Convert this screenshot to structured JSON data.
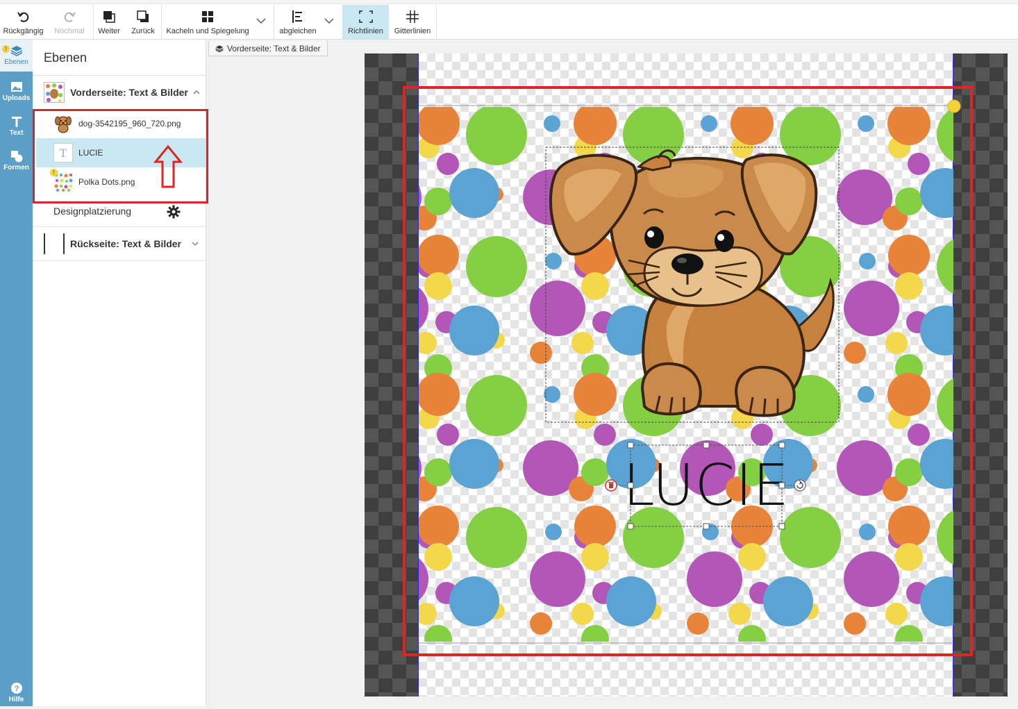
{
  "toolbar": {
    "undo": "Rückgängig",
    "redo": "Nochmal",
    "forward": "Weiter",
    "backward": "Zurück",
    "tiles": "Kacheln und Spiegelung",
    "align": "abgleichen",
    "guides": "Richtlinien",
    "grid": "Gitterlinien"
  },
  "rail": {
    "layers": "Ebenen",
    "uploads": "Uploads",
    "text": "Text",
    "shapes": "Formen",
    "help": "Hilfe"
  },
  "panel": {
    "title": "Ebenen",
    "front_group": "Vorderseite: Text & Bilder",
    "layers": [
      {
        "name": "dog-3542195_960_720.png"
      },
      {
        "name": "LUCIE"
      },
      {
        "name": "Polka Dots.png"
      }
    ],
    "placement": "Designplatzierung",
    "back_group": "Rückseite: Text & Bilder"
  },
  "canvas": {
    "tab_label": "Vorderseite: Text & Bilder",
    "text_layer": "LUCIE"
  },
  "colors": {
    "rail": "#5b9ec6",
    "selected_row": "#c9e8f1",
    "annotation_red": "#e02424",
    "dot_orange": "#e8843a",
    "dot_green": "#84cf43",
    "dot_blue": "#5aa3d3",
    "dot_purple": "#b257b8",
    "dot_yellow": "#f2d84a"
  },
  "icons": [
    "undo-icon",
    "redo-icon",
    "forward-icon",
    "backward-icon",
    "tiles-icon",
    "align-icon",
    "guides-icon",
    "grid-icon",
    "layers-icon",
    "uploads-icon",
    "text-icon",
    "shapes-icon",
    "help-icon",
    "gear-icon",
    "chevron-up-icon",
    "chevron-down-icon",
    "delete-icon",
    "rotate-icon"
  ]
}
